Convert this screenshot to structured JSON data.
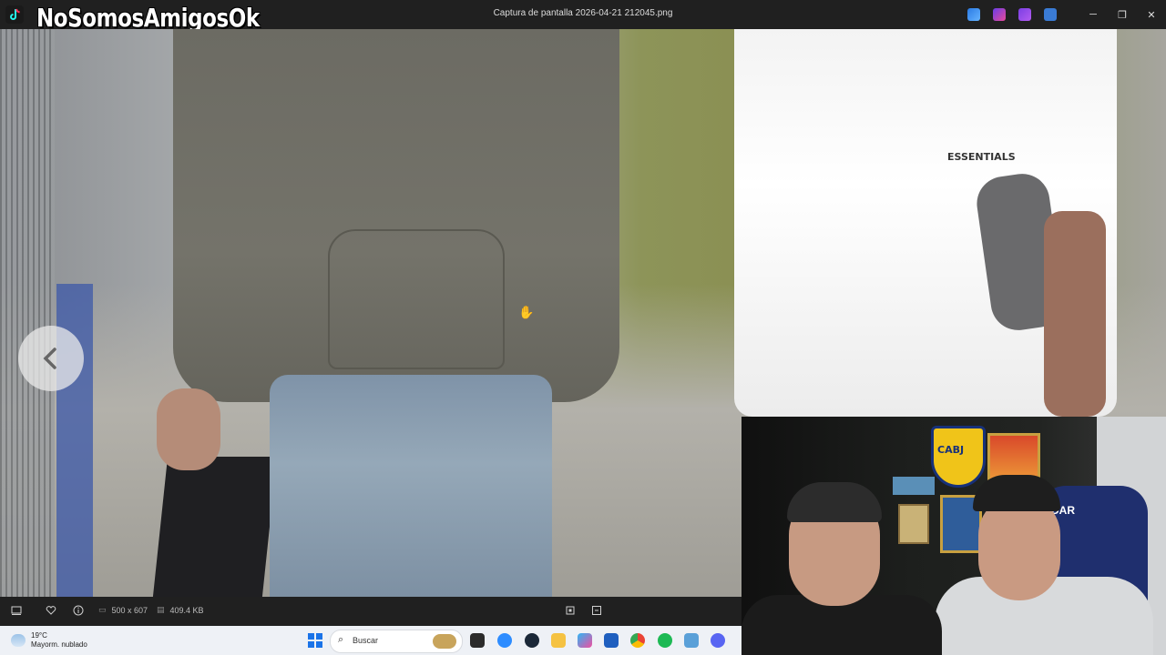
{
  "titlebar": {
    "brand": "NoSomosAmigosOk",
    "window_title": "Captura de pantalla 2026-04-21 212045.png",
    "controls": {
      "minimize": "─",
      "maximize": "❐",
      "close": "✕"
    }
  },
  "viewer": {
    "prev_label": "‹",
    "tshirt_text": "ESSENTIALS"
  },
  "footer": {
    "dimensions": "500 x 607",
    "file_size": "409.4 KB"
  },
  "webcam": {
    "crest_text": "CABJ",
    "chair_text": "DAR"
  },
  "taskbar": {
    "weather_temp": "19°C",
    "weather_desc": "Mayorm. nublado",
    "search_placeholder": "Buscar"
  },
  "colors": {
    "titlebar_bg": "#202020",
    "taskbar_bg": "#eef1f6",
    "accent": "#1a73e8"
  }
}
